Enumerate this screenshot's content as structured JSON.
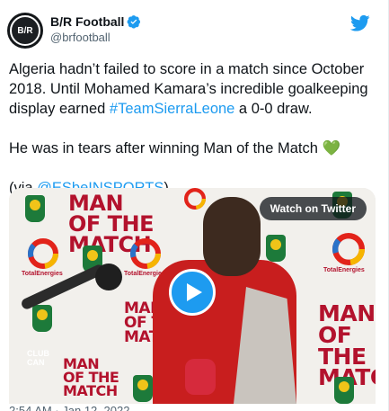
{
  "account": {
    "display_name": "B/R Football",
    "handle": "@brfootball",
    "avatar_text": "B/R"
  },
  "tweet": {
    "line1_prefix": "Algeria hadn’t failed to score in a match since October 2018. Until Mohamed Kamara’s incredible goalkeeping display earned ",
    "hashtag": "#TeamSierraLeone",
    "line1_suffix": " a 0-0 draw.",
    "line2": "He was in tears after winning Man of the Match ",
    "heart_emoji": "💚",
    "via_prefix": "(via ",
    "via_mention": "@ESbeINSPORTS",
    "via_suffix": ")"
  },
  "media": {
    "watch_label": "Watch on Twitter",
    "brand_text_1": "MAN\nOF THE\nMATCH",
    "sponsor": "TotalEnergies",
    "club_text": "CLUB\nCAN"
  },
  "timestamp": "2:54 AM · Jan 12, 2022",
  "colors": {
    "accent": "#1d9bf0",
    "text": "#0f1419",
    "muted": "#536471",
    "brand_red": "#b3122d"
  }
}
